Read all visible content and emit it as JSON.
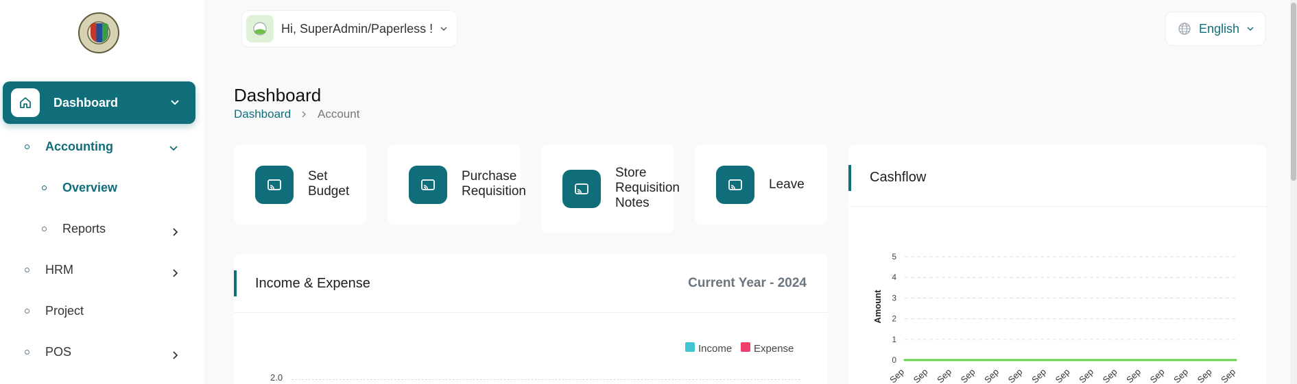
{
  "sidebar": {
    "dashboard_label": "Dashboard",
    "items": [
      {
        "label": "Accounting"
      },
      {
        "label": "Overview"
      },
      {
        "label": "Reports"
      },
      {
        "label": "HRM"
      },
      {
        "label": "Project"
      },
      {
        "label": "POS"
      }
    ]
  },
  "header": {
    "greeting": "Hi, SuperAdmin/Paperless !",
    "language": "English"
  },
  "page": {
    "title": "Dashboard",
    "breadcrumb": [
      "Dashboard",
      "Account"
    ]
  },
  "quick_actions": [
    {
      "lines": [
        "Set",
        "Budget"
      ]
    },
    {
      "lines": [
        "Purchase",
        "Requisition"
      ]
    },
    {
      "lines": [
        "Store",
        "Requisition",
        "Notes"
      ]
    },
    {
      "lines": [
        "Leave"
      ]
    }
  ],
  "income_expense": {
    "title": "Income & Expense",
    "period": "Current Year - 2024",
    "legend": [
      "Income",
      "Expense"
    ],
    "visible_tick": "2.0"
  },
  "cashflow": {
    "title": "Cashflow"
  },
  "colors": {
    "accent": "#0f6e7a",
    "income": "#3fc6d1",
    "expense": "#f0416c",
    "cashflow_line": "#66d04a"
  },
  "chart_data": {
    "type": "line",
    "title": "Cashflow",
    "ylabel": "Amount",
    "ylim": [
      0,
      5
    ],
    "y_ticks": [
      "0",
      "1",
      "2",
      "3",
      "4",
      "5"
    ],
    "categories": [
      "Sep",
      "Sep",
      "Sep",
      "Sep",
      "Sep",
      "Sep",
      "Sep",
      "Sep",
      "Sep",
      "Sep",
      "Sep",
      "Sep",
      "Sep",
      "Sep",
      "Sep"
    ],
    "values": [
      0,
      0,
      0,
      0,
      0,
      0,
      0,
      0,
      0,
      0,
      0,
      0,
      0,
      0,
      0
    ],
    "grid": true
  }
}
